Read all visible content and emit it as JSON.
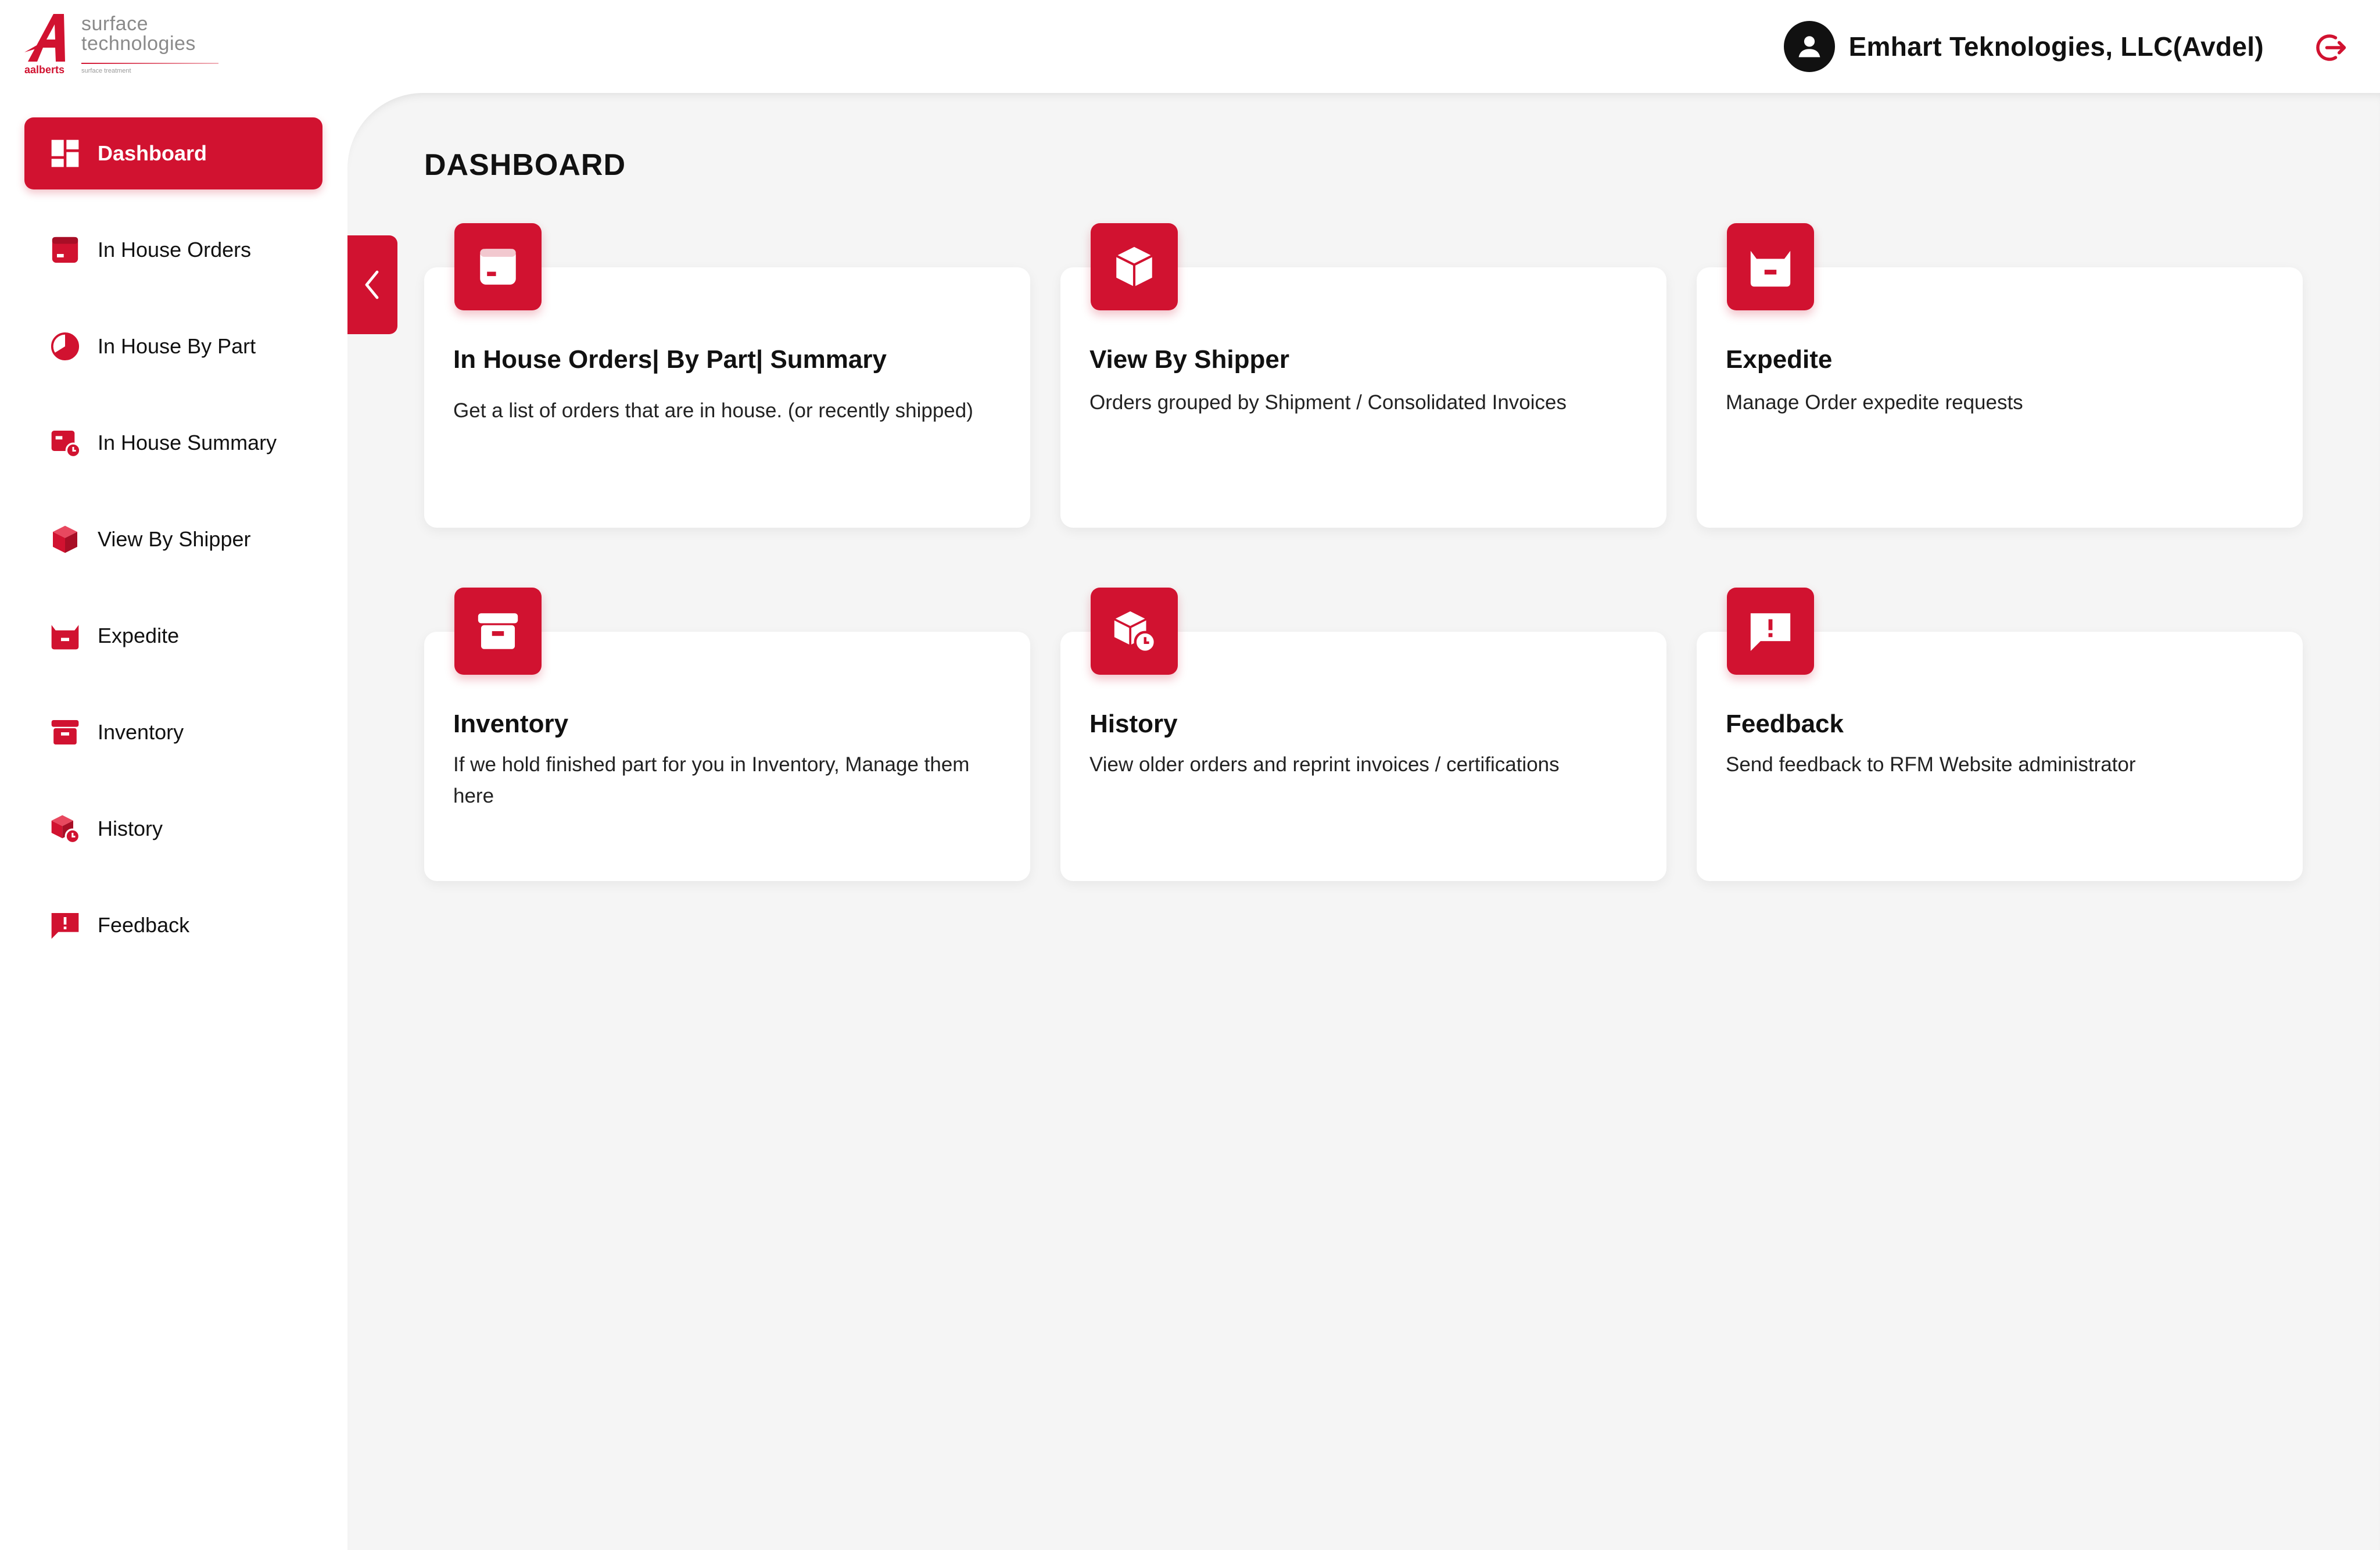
{
  "brand": {
    "logo_line1": "surface",
    "logo_line2": "technologies",
    "logo_brand": "aalberts",
    "logo_sub": "surface treatment",
    "accent_color": "#d11230"
  },
  "header": {
    "user_name": "Emhart Teknologies, LLC(Avdel)",
    "user_icon": "user-avatar-icon",
    "logout_icon": "logout-icon"
  },
  "sidebar": {
    "items": [
      {
        "label": "Dashboard",
        "icon": "dashboard-icon",
        "active": true
      },
      {
        "label": "In House Orders",
        "icon": "orders-icon"
      },
      {
        "label": "In House By Part",
        "icon": "pie-chart-icon"
      },
      {
        "label": "In House Summary",
        "icon": "summary-icon"
      },
      {
        "label": "View By Shipper",
        "icon": "box-icon"
      },
      {
        "label": "Expedite",
        "icon": "basket-icon"
      },
      {
        "label": "Inventory",
        "icon": "archive-icon"
      },
      {
        "label": "History",
        "icon": "history-icon"
      },
      {
        "label": "Feedback",
        "icon": "feedback-icon"
      }
    ]
  },
  "main": {
    "title": "DASHBOARD",
    "collapse_icon": "chevron-left-icon",
    "cards": [
      {
        "title": "In House Orders| By Part| Summary",
        "description": "Get a list of orders that are in house. (or recently shipped)",
        "icon": "orders-icon"
      },
      {
        "title": "View By Shipper",
        "description": "Orders grouped by Shipment / Consolidated Invoices",
        "icon": "box-icon"
      },
      {
        "title": "Expedite",
        "description": "Manage Order expedite requests",
        "icon": "basket-icon"
      },
      {
        "title": "Inventory",
        "description": "If we hold finished part for you in Inventory, Manage them here",
        "icon": "archive-icon"
      },
      {
        "title": "History",
        "description": "View older orders and reprint invoices / certifications",
        "icon": "history-icon"
      },
      {
        "title": "Feedback",
        "description": "Send feedback to RFM Website administrator",
        "icon": "feedback-icon"
      }
    ]
  }
}
